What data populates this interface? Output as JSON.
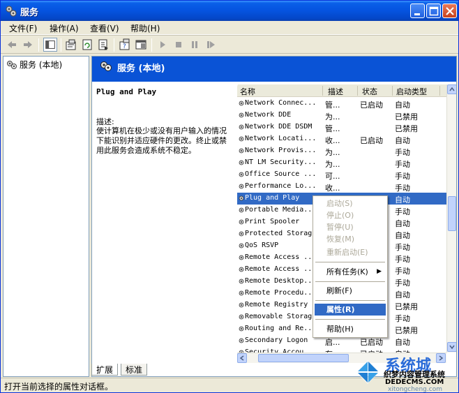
{
  "window": {
    "title": "服务",
    "minimize": "minimize",
    "maximize": "maximize",
    "close": "close"
  },
  "menu": [
    {
      "label": "文件(F)"
    },
    {
      "label": "操作(A)"
    },
    {
      "label": "查看(V)"
    },
    {
      "label": "帮助(H)"
    }
  ],
  "toolbar": {
    "icons": [
      "back-icon",
      "forward-icon",
      "show-tree-icon",
      "properties-icon",
      "refresh-icon",
      "export-icon",
      "help-icon",
      "console-icon",
      "play-icon",
      "stop-icon",
      "pause-icon",
      "restart-icon"
    ]
  },
  "tree": {
    "root_label": "服务 (本地)"
  },
  "panel": {
    "header_title": "服务 (本地)",
    "selected_service": "Plug and Play",
    "description_label": "描述:",
    "description": "使计算机在极少或没有用户输入的情况下能识别并适应硬件的更改。终止或禁用此服务会造成系统不稳定。"
  },
  "list": {
    "columns": [
      "名称",
      "描述",
      "状态",
      "启动类型"
    ],
    "rows": [
      {
        "name": "Network Connec...",
        "desc": "管...",
        "status": "已启动",
        "startup": "自动"
      },
      {
        "name": "Network DDE",
        "desc": "为...",
        "status": "",
        "startup": "已禁用"
      },
      {
        "name": "Network DDE DSDM",
        "desc": "管...",
        "status": "",
        "startup": "已禁用"
      },
      {
        "name": "Network Locati...",
        "desc": "收...",
        "status": "已启动",
        "startup": "自动"
      },
      {
        "name": "Network Provis...",
        "desc": "为...",
        "status": "",
        "startup": "手动"
      },
      {
        "name": "NT LM Security...",
        "desc": "为...",
        "status": "",
        "startup": "手动"
      },
      {
        "name": "Office Source ...",
        "desc": "可...",
        "status": "",
        "startup": "手动"
      },
      {
        "name": "Performance Lo...",
        "desc": "收...",
        "status": "",
        "startup": "手动"
      },
      {
        "name": "Plug and Play",
        "desc": "",
        "status": "",
        "startup": "自动",
        "selected": true
      },
      {
        "name": "Portable Media...",
        "desc": "",
        "status": "",
        "startup": "手动"
      },
      {
        "name": "Print Spooler",
        "desc": "",
        "status": "",
        "startup": "自动"
      },
      {
        "name": "Protected Storag",
        "desc": "",
        "status": "",
        "startup": "自动"
      },
      {
        "name": "QoS RSVP",
        "desc": "",
        "status": "",
        "startup": "手动"
      },
      {
        "name": "Remote Access ...",
        "desc": "",
        "status": "",
        "startup": "手动"
      },
      {
        "name": "Remote Access ...",
        "desc": "",
        "status": "",
        "startup": "手动"
      },
      {
        "name": "Remote Desktop...",
        "desc": "",
        "status": "",
        "startup": "手动"
      },
      {
        "name": "Remote Procedu...",
        "desc": "",
        "status": "",
        "startup": "自动"
      },
      {
        "name": "Remote Registry",
        "desc": "",
        "status": "",
        "startup": "已禁用"
      },
      {
        "name": "Removable Storag",
        "desc": "",
        "status": "",
        "startup": "手动"
      },
      {
        "name": "Routing and Re...",
        "desc": "",
        "status": "",
        "startup": "已禁用"
      },
      {
        "name": "Secondary Logon",
        "desc": "启...",
        "status": "已启动",
        "startup": "自动"
      },
      {
        "name": "Security Accou...",
        "desc": "存...",
        "status": "已启动",
        "startup": "自动"
      }
    ]
  },
  "context_menu": {
    "start": "启动(S)",
    "stop": "停止(O)",
    "pause": "暂停(U)",
    "resume": "恢复(M)",
    "restart": "重新启动(E)",
    "all_tasks": "所有任务(K)",
    "refresh": "刷新(F)",
    "properties": "属性(R)",
    "help": "帮助(H)"
  },
  "tabs": [
    {
      "label": "扩展"
    },
    {
      "label": "标准"
    }
  ],
  "status": {
    "text": "打开当前选择的属性对话框。"
  },
  "watermark": {
    "brand": "系统城",
    "cn": "织梦内容管理系统",
    "domain": "DEDECMS.COM",
    "url": "xitongcheng.com"
  },
  "colors": {
    "selection": "#316ac5",
    "title_bar": "#0553df",
    "header": "#0a53d6"
  }
}
